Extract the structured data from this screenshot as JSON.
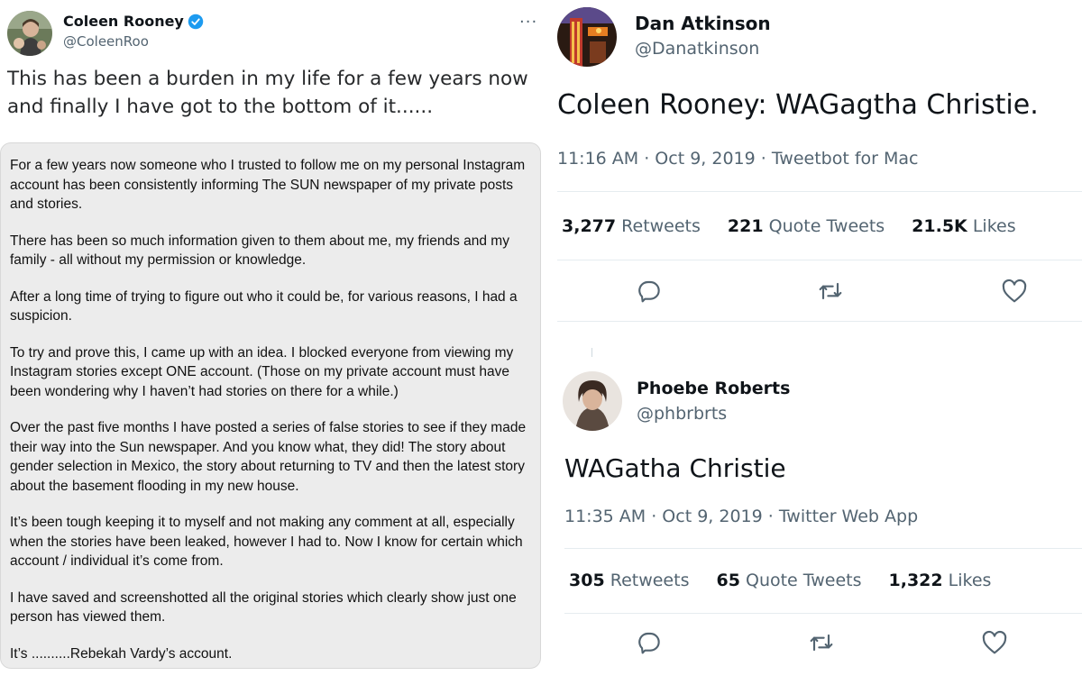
{
  "left_tweet": {
    "name": "Coleen Rooney",
    "handle": "@ColeenRoo",
    "text": "This has been a burden in my life for a few years now and finally I have got to the bottom of it......",
    "statement": [
      "For a few years now someone who I trusted to follow me on my personal Instagram account has been consistently informing The SUN newspaper of my private posts and stories.",
      "There has been so much information given to them about me, my friends and my family - all without my permission or knowledge.",
      "After a long time of trying to figure out who it could be, for various reasons, I had a suspicion.",
      "To try and prove this, I came up with an idea. I blocked everyone from viewing my Instagram stories except ONE account. (Those on my private account must have been wondering why I haven’t had stories on there for a while.)",
      "Over the past five months I have posted a series of false stories to see if they made their way into the Sun newspaper. And you know what, they did! The story about gender selection in Mexico, the story about returning to TV and then the latest story about the basement flooding in my new house.",
      "It’s been tough keeping it to myself and not making any comment at all, especially when the stories have been leaked, however I had to. Now I know for certain which account  / individual it’s come from.",
      "I have saved and screenshotted all the original stories which clearly show just one person has viewed them.",
      "It’s ..........Rebekah Vardy’s account."
    ],
    "verified_icon": "verified-badge-icon",
    "more_icon": "more-dots-icon"
  },
  "tweet1": {
    "name": "Dan Atkinson",
    "handle": "@Danatkinson",
    "text": "Coleen Rooney: WAGagtha Christie.",
    "meta": "11:16 AM · Oct 9, 2019 · Tweetbot for Mac",
    "retweets": "3,277",
    "retweets_label": "Retweets",
    "quotes": "221",
    "quotes_label": "Quote Tweets",
    "likes": "21.5K",
    "likes_label": "Likes"
  },
  "tweet2": {
    "name": "Phoebe Roberts",
    "handle": "@phbrbrts",
    "text": "WAGatha Christie",
    "meta": "11:35 AM · Oct 9, 2019 · Twitter Web App",
    "retweets": "305",
    "retweets_label": "Retweets",
    "quotes": "65",
    "quotes_label": "Quote Tweets",
    "likes": "1,322",
    "likes_label": "Likes"
  },
  "icons": {
    "reply": "reply-icon",
    "retweet": "retweet-icon",
    "like": "heart-icon"
  },
  "colors": {
    "text": "#0f1419",
    "secondary": "#536471",
    "verified": "#1d9bf0",
    "statement_bg": "#ececec"
  }
}
